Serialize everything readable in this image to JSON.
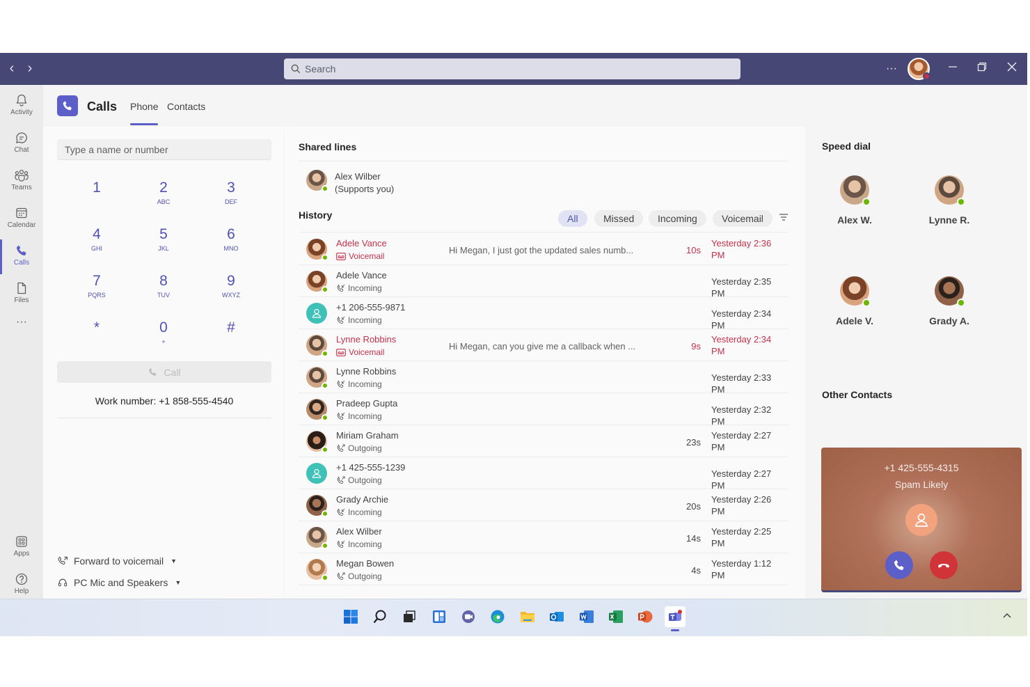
{
  "titlebar": {
    "search_placeholder": "Search",
    "more_label": "···"
  },
  "rail": [
    {
      "label": "Activity",
      "icon": "bell-icon"
    },
    {
      "label": "Chat",
      "icon": "chat-icon"
    },
    {
      "label": "Teams",
      "icon": "teams-icon"
    },
    {
      "label": "Calendar",
      "icon": "calendar-icon"
    },
    {
      "label": "Calls",
      "icon": "phone-icon",
      "active": true
    },
    {
      "label": "Files",
      "icon": "file-icon"
    },
    {
      "label": "···",
      "icon": "more-icon"
    },
    {
      "label": "Apps",
      "icon": "apps-icon"
    },
    {
      "label": "Help",
      "icon": "help-icon"
    }
  ],
  "header": {
    "title": "Calls",
    "tabs": [
      {
        "label": "Phone",
        "active": true
      },
      {
        "label": "Contacts",
        "active": false
      }
    ]
  },
  "dialer": {
    "input_placeholder": "Type a name or number",
    "keys": [
      {
        "num": "1",
        "letters": ""
      },
      {
        "num": "2",
        "letters": "ABC"
      },
      {
        "num": "3",
        "letters": "DEF"
      },
      {
        "num": "4",
        "letters": "GHI"
      },
      {
        "num": "5",
        "letters": "JKL"
      },
      {
        "num": "6",
        "letters": "MNO"
      },
      {
        "num": "7",
        "letters": "PQRS"
      },
      {
        "num": "8",
        "letters": "TUV"
      },
      {
        "num": "9",
        "letters": "WXYZ"
      },
      {
        "num": "*",
        "letters": ""
      },
      {
        "num": "0",
        "letters": "+"
      },
      {
        "num": "#",
        "letters": ""
      }
    ],
    "call_label": "Call",
    "work_number": "Work number: +1 858-555-4540",
    "forward_label": "Forward to voicemail",
    "device_label": "PC Mic and Speakers"
  },
  "shared_lines": {
    "title": "Shared lines",
    "name": "Alex Wilber",
    "note": "(Supports you)"
  },
  "history": {
    "title": "History",
    "filters": [
      {
        "label": "All",
        "active": true
      },
      {
        "label": "Missed",
        "active": false
      },
      {
        "label": "Incoming",
        "active": false
      },
      {
        "label": "Voicemail",
        "active": false
      }
    ],
    "rows": [
      {
        "name": "Adele Vance",
        "kind": "Voicemail",
        "preview": "Hi Megan, I just got the updated sales numb...",
        "duration": "10s",
        "time_l1": "Yesterday 2:36",
        "time_l2": "PM",
        "missed": true,
        "avatar": "teal-woman"
      },
      {
        "name": "Adele Vance",
        "kind": "Incoming",
        "preview": "",
        "duration": "",
        "time_l1": "Yesterday 2:35 PM",
        "time_l2": "",
        "missed": false,
        "avatar": "teal-woman"
      },
      {
        "name": "+1 206-555-9871",
        "kind": "Incoming",
        "preview": "",
        "duration": "",
        "time_l1": "Yesterday 2:34 PM",
        "time_l2": "",
        "missed": false,
        "avatar": "generic"
      },
      {
        "name": "Lynne Robbins",
        "kind": "Voicemail",
        "preview": "Hi Megan, can you give me a callback when ...",
        "duration": "9s",
        "time_l1": "Yesterday 2:34",
        "time_l2": "PM",
        "missed": true,
        "avatar": "man-a"
      },
      {
        "name": "Lynne Robbins",
        "kind": "Incoming",
        "preview": "",
        "duration": "",
        "time_l1": "Yesterday 2:33 PM",
        "time_l2": "",
        "missed": false,
        "avatar": "man-a"
      },
      {
        "name": "Pradeep Gupta",
        "kind": "Incoming",
        "preview": "",
        "duration": "",
        "time_l1": "Yesterday 2:32 PM",
        "time_l2": "",
        "missed": false,
        "avatar": "man-b"
      },
      {
        "name": "Miriam Graham",
        "kind": "Outgoing",
        "preview": "",
        "duration": "23s",
        "time_l1": "Yesterday 2:27",
        "time_l2": "PM",
        "missed": false,
        "avatar": "woman-b"
      },
      {
        "name": "+1 425-555-1239",
        "kind": "Outgoing",
        "preview": "",
        "duration": "",
        "time_l1": "Yesterday 2:27 PM",
        "time_l2": "",
        "missed": false,
        "avatar": "generic"
      },
      {
        "name": "Grady Archie",
        "kind": "Incoming",
        "preview": "",
        "duration": "20s",
        "time_l1": "Yesterday 2:26",
        "time_l2": "PM",
        "missed": false,
        "avatar": "man-c"
      },
      {
        "name": "Alex Wilber",
        "kind": "Incoming",
        "preview": "",
        "duration": "14s",
        "time_l1": "Yesterday 2:25",
        "time_l2": "PM",
        "missed": false,
        "avatar": "man-d"
      },
      {
        "name": "Megan Bowen",
        "kind": "Outgoing",
        "preview": "",
        "duration": "4s",
        "time_l1": "Yesterday 1:12",
        "time_l2": "PM",
        "missed": false,
        "avatar": "woman-c"
      }
    ]
  },
  "speed_dial": {
    "title": "Speed dial",
    "contacts": [
      {
        "label": "Alex W."
      },
      {
        "label": "Lynne R."
      },
      {
        "label": "Adele V."
      },
      {
        "label": "Grady A."
      }
    ],
    "other_title": "Other Contacts"
  },
  "incoming_call": {
    "number": "+1 425-555-4315",
    "status": "Spam Likely"
  },
  "colors": {
    "brand": "#5b5fc7",
    "titlebar": "#464775",
    "missed": "#c4314b",
    "presence_available": "#6bb700"
  }
}
